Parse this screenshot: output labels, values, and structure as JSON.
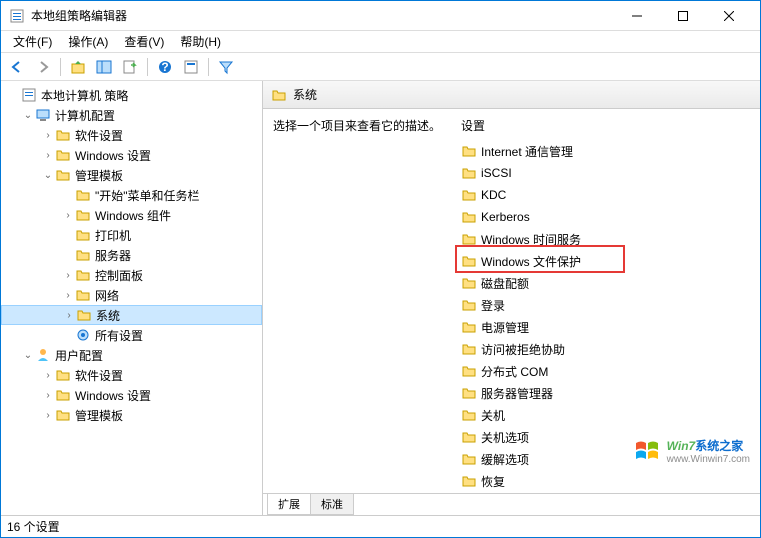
{
  "window": {
    "title": "本地组策略编辑器"
  },
  "menu": {
    "file": "文件(F)",
    "action": "操作(A)",
    "view": "查看(V)",
    "help": "帮助(H)"
  },
  "tree": {
    "root": "本地计算机 策略",
    "computer": "计算机配置",
    "c_software": "软件设置",
    "c_windows": "Windows 设置",
    "c_admin": "管理模板",
    "c_start": "\"开始\"菜单和任务栏",
    "c_wincomp": "Windows 组件",
    "c_printer": "打印机",
    "c_server": "服务器",
    "c_cpanel": "控制面板",
    "c_network": "网络",
    "c_system": "系统",
    "c_allset": "所有设置",
    "user": "用户配置",
    "u_software": "软件设置",
    "u_windows": "Windows 设置",
    "u_admin": "管理模板"
  },
  "rightHeader": "系统",
  "desc": "选择一个项目来查看它的描述。",
  "listHeader": "设置",
  "items": [
    "Internet 通信管理",
    "iSCSI",
    "KDC",
    "Kerberos",
    "Windows 时间服务",
    "Windows 文件保护",
    "磁盘配额",
    "登录",
    "电源管理",
    "访问被拒绝协助",
    "分布式 COM",
    "服务器管理器",
    "关机",
    "关机选项",
    "缓解选项",
    "恢复"
  ],
  "tabs": {
    "extended": "扩展",
    "standard": "标准"
  },
  "status": "16 个设置",
  "watermark": {
    "brand1": "Win7",
    "brand2": "系统之家",
    "url": "www.Winwin7.com"
  }
}
